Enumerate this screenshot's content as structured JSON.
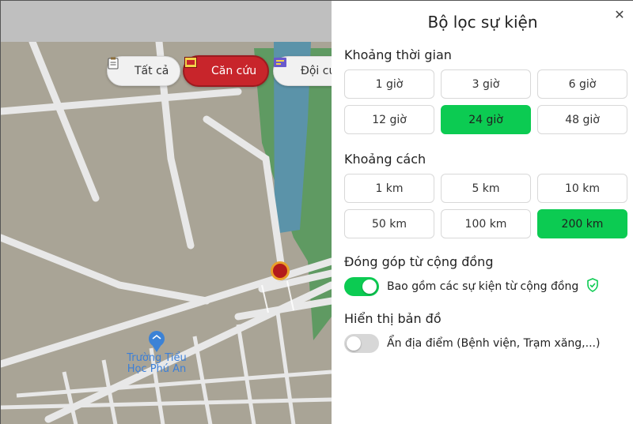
{
  "map": {
    "chips": [
      {
        "label": "Tất cả",
        "icon": "clipboard-icon",
        "active": false
      },
      {
        "label": "Căn cứu",
        "icon": "sos-icon",
        "active": true
      },
      {
        "label": "Đội cứ",
        "icon": "team-icon",
        "active": false
      }
    ],
    "poi_label": "Trường Tiểu\nHọc Phú An",
    "colors": {
      "land": "#a9a496",
      "road": "#e6e6e6",
      "water": "#5b93a9",
      "park": "#5f9a62",
      "accent_red": "#c8252b"
    }
  },
  "panel": {
    "title": "Bộ lọc sự kiện",
    "close_icon": "close-icon",
    "time": {
      "title": "Khoảng thời gian",
      "options": [
        "1 giờ",
        "3 giờ",
        "6 giờ",
        "12 giờ",
        "24 giờ",
        "48 giờ"
      ],
      "selected": "24 giờ"
    },
    "distance": {
      "title": "Khoảng cách",
      "options": [
        "1 km",
        "5 km",
        "10 km",
        "50 km",
        "100 km",
        "200 km"
      ],
      "selected": "200 km"
    },
    "community": {
      "title": "Đóng góp từ cộng đồng",
      "toggle_label": "Bao gồm các sự kiện từ cộng đồng",
      "enabled": true,
      "icon": "shield-check-icon"
    },
    "map_display": {
      "title": "Hiển thị bản đồ",
      "toggle_label": "Ẩn địa điểm (Bệnh viện, Trạm xăng,...)",
      "enabled": false
    },
    "accent_color": "#0ccb52"
  }
}
